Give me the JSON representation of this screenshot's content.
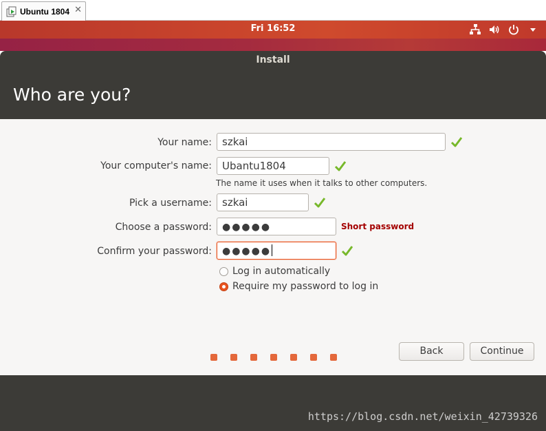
{
  "host_tab": {
    "label": "Ubuntu 1804",
    "close_symbol": "✕",
    "icon": "vm-icon"
  },
  "top_bar": {
    "clock": "Fri 16:52",
    "tray_icons": [
      "network-icon",
      "volume-icon",
      "power-icon",
      "chevron-down-icon"
    ]
  },
  "window": {
    "title": "Install",
    "page_title": "Who are you?"
  },
  "form": {
    "name": {
      "label": "Your name:",
      "value": "szkai",
      "valid": true
    },
    "computer": {
      "label": "Your computer's name:",
      "value": "Ubantu1804",
      "hint": "The name it uses when it talks to other computers.",
      "valid": true
    },
    "username": {
      "label": "Pick a username:",
      "value": "szkai",
      "valid": true
    },
    "password": {
      "label": "Choose a password:",
      "value": "●●●●●",
      "strength": "Short password"
    },
    "confirm": {
      "label": "Confirm your password:",
      "value": "●●●●●",
      "valid": true
    },
    "login_options": [
      {
        "label": "Log in automatically",
        "selected": false
      },
      {
        "label": "Require my password to log in",
        "selected": true
      }
    ]
  },
  "buttons": {
    "back": "Back",
    "continue": "Continue"
  },
  "progress_dots": 7,
  "watermark": "https://blog.csdn.net/weixin_42739326",
  "colors": {
    "accent": "#e95420",
    "check": "#77b82a",
    "warning": "#a40000",
    "window": "#3c3b37",
    "content": "#f7f6f5"
  }
}
